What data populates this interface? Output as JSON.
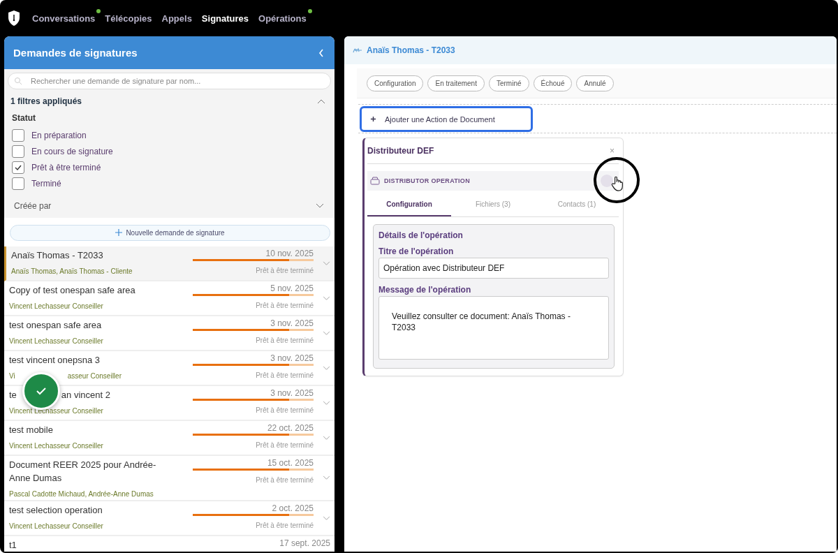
{
  "nav": [
    {
      "label": "Conversations",
      "selected": false,
      "badge": true
    },
    {
      "label": "Télécopies",
      "selected": false,
      "badge": false
    },
    {
      "label": "Appels",
      "selected": false,
      "badge": false
    },
    {
      "label": "Signatures",
      "selected": true,
      "badge": false
    },
    {
      "label": "Opérations",
      "selected": false,
      "badge": true
    }
  ],
  "sidebar": {
    "title": "Demandes de signatures",
    "search": {
      "placeholder": "Rechercher une demande de signature par nom..."
    },
    "filters_summary": "1 filtres appliqués",
    "filters_expanded": true,
    "status_label": "Statut",
    "statuses": [
      {
        "label": "En préparation",
        "checked": false
      },
      {
        "label": "En cours de signature",
        "checked": false
      },
      {
        "label": "Prêt à être terminé",
        "checked": true
      },
      {
        "label": "Terminé",
        "checked": false
      }
    ],
    "created_by": "Créée par",
    "new_button": "Nouvelle demande de signature",
    "requests": [
      {
        "title": [
          "Anaïs Thomas - T2033"
        ],
        "people": [
          "Anaïs Thomas, Anaïs Thomas - Cliente"
        ],
        "date": "10 nov. 2025",
        "level": 0.8,
        "status": "Prêt à être terminé",
        "selected": true
      },
      {
        "title": [
          "Copy of test onespan safe area"
        ],
        "people": [
          "Vincent Lechasseur Conseiller"
        ],
        "date": "5 nov. 2025",
        "level": 0.8,
        "status": "Prêt à être terminé",
        "selected": false
      },
      {
        "title": [
          "test onespan safe area"
        ],
        "people": [
          "Vincent Lechasseur Conseiller"
        ],
        "date": "3 nov. 2025",
        "level": 0.8,
        "status": "Prêt à être terminé",
        "selected": false
      },
      {
        "title": [
          "test vincent onepsna 3"
        ],
        "people": [
          "Vi",
          "asseur Conseiller"
        ],
        "date": "3 nov. 2025",
        "level": 0.8,
        "status": "Prêt à être terminé",
        "selected": false
      },
      {
        "title": [
          "te",
          "an vincent 2"
        ],
        "people": [
          "Vincent Lechasseur Conseiller"
        ],
        "date": "3 nov. 2025",
        "level": 0.8,
        "status": "Prêt à être terminé",
        "selected": false
      },
      {
        "title": [
          "test mobile"
        ],
        "people": [
          "Vincent Lechasseur Conseiller"
        ],
        "date": "22 oct. 2025",
        "level": 0.8,
        "status": "Prêt à être terminé",
        "selected": false
      },
      {
        "title": [
          "Document REER 2025 pour Andrée-Anne Dumas"
        ],
        "people": [
          "Pascal Cadotte Michaud, Andrée-Anne Dumas"
        ],
        "date": "15 oct. 2025",
        "level": 0.8,
        "status": "Prêt à être terminé",
        "selected": false
      },
      {
        "title": [
          "test selection operation"
        ],
        "people": [
          "Vincent Lechasseur Conseiller"
        ],
        "date": "2 oct. 2025",
        "level": 0.8,
        "status": "Prêt à être terminé",
        "selected": false
      },
      {
        "title": [
          "t1"
        ],
        "date": "17 sept. 2025",
        "selected": false
      }
    ]
  },
  "detail": {
    "title": "Anaïs Thomas - T2033",
    "status_filters": [
      "Configuration",
      "En traitement",
      "Terminé",
      "Échoué",
      "Annulé"
    ],
    "add_action": "Ajouter une Action de Document",
    "card": {
      "title": "Distributeur DEF",
      "close": "×",
      "section": "DISTRIBUTOR OPERATION",
      "tabs": [
        {
          "label": "Configuration",
          "selected": true
        },
        {
          "label": "Fichiers (3)",
          "selected": false
        },
        {
          "label": "Contacts (1)",
          "selected": false
        }
      ],
      "group_title": "Détails de l'opération",
      "title_label": "Titre de l'opération",
      "title_value": "Opération avec Distributeur DEF",
      "message_label": "Message de l'opération",
      "message_value": "Veuillez consulter ce document: Anaïs Thomas - T2033"
    }
  }
}
